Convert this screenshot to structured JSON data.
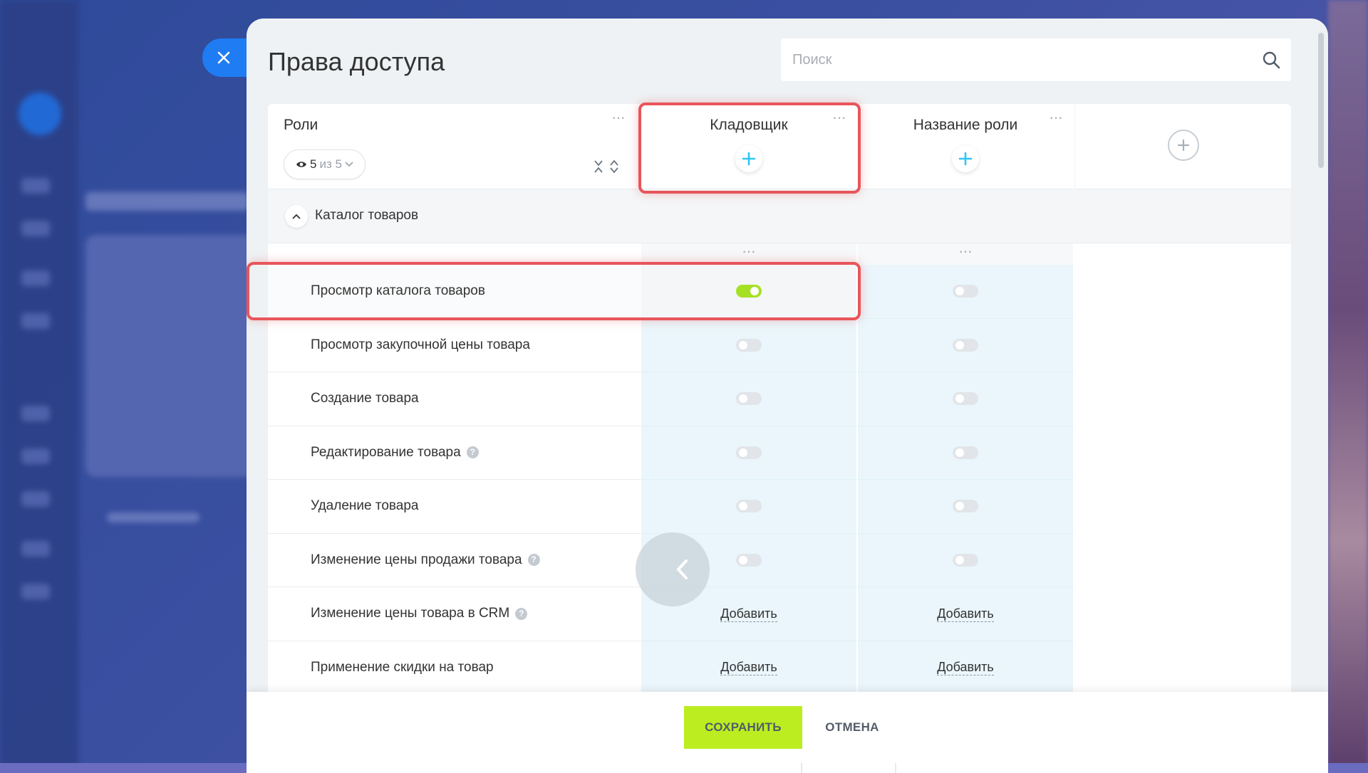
{
  "panel": {
    "title": "Права доступа",
    "search_placeholder": "Поиск"
  },
  "roles_column": {
    "label": "Роли",
    "visible_count": "5",
    "visible_total": "из 5"
  },
  "roles": [
    {
      "name": "Кладовщик"
    },
    {
      "name": "Название роли"
    }
  ],
  "section": {
    "title": "Каталог товаров"
  },
  "permissions": [
    {
      "label": "Просмотр каталога товаров",
      "help": false,
      "values": [
        "toggle-on",
        "toggle-off"
      ]
    },
    {
      "label": "Просмотр закупочной цены товара",
      "help": false,
      "values": [
        "toggle-off",
        "toggle-off"
      ]
    },
    {
      "label": "Создание товара",
      "help": false,
      "values": [
        "toggle-off",
        "toggle-off"
      ]
    },
    {
      "label": "Редактирование товара",
      "help": true,
      "values": [
        "toggle-off",
        "toggle-off"
      ]
    },
    {
      "label": "Удаление товара",
      "help": false,
      "values": [
        "toggle-off",
        "toggle-off"
      ]
    },
    {
      "label": "Изменение цены продажи товара",
      "help": true,
      "values": [
        "toggle-off",
        "toggle-off"
      ]
    },
    {
      "label": "Изменение цены товара в CRM",
      "help": true,
      "values": [
        "add",
        "add"
      ]
    },
    {
      "label": "Применение скидки на товар",
      "help": false,
      "values": [
        "add",
        "add"
      ]
    }
  ],
  "add_link_label": "Добавить",
  "footer": {
    "save_label": "СОХРАНИТЬ",
    "cancel_label": "ОТМЕНА"
  },
  "colors": {
    "accent_green": "#bbed21",
    "toggle_on": "#a6e024",
    "highlight_red": "#e8555b",
    "close_blue": "#1f7cf2",
    "plus_blue": "#2fc6f6"
  },
  "icons": {
    "close": "close-icon",
    "search": "search-icon",
    "eye": "eye-icon",
    "plus": "plus-icon",
    "chevron_up": "chevron-up-icon",
    "chevron_left": "chevron-left-icon",
    "help": "help-icon"
  }
}
